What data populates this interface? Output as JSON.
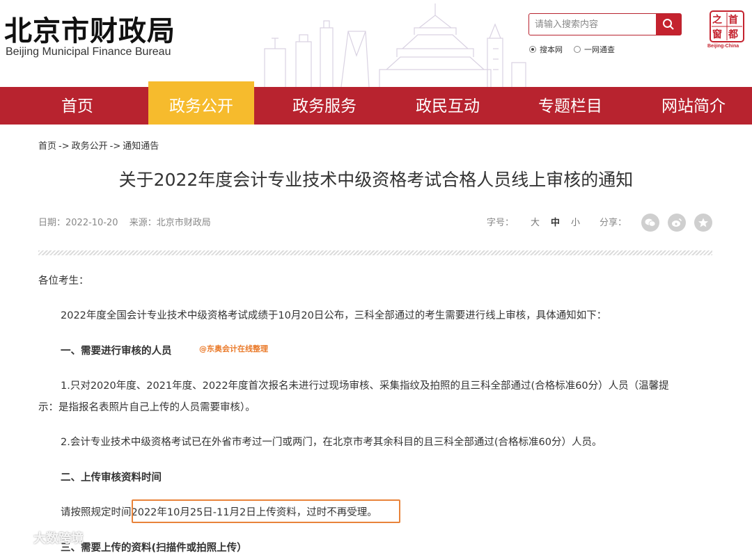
{
  "header": {
    "logo_cn": "北京市财政局",
    "logo_en": "Beijing Municipal Finance Bureau",
    "search_placeholder": "请输入搜索内容",
    "scope_options": [
      "搜本网",
      "一网通查"
    ],
    "seal_chars": [
      "首",
      "都",
      "之",
      "窗"
    ],
    "seal_caption": "Beijing-China"
  },
  "nav": {
    "items": [
      "首页",
      "政务公开",
      "政务服务",
      "政民互动",
      "专题栏目",
      "网站简介"
    ],
    "active_index": 1
  },
  "breadcrumb": [
    "首页",
    "政务公开",
    "通知通告"
  ],
  "breadcrumb_sep": "->",
  "article": {
    "title": "关于2022年度会计专业技术中级资格考试合格人员线上审核的通知",
    "date": "日期：2022-10-20",
    "source": "来源：北京市财政局",
    "font_size_label": "字号：",
    "font_sizes": [
      "大",
      "中",
      "小"
    ],
    "share_label": "分享：",
    "share_icons": [
      "wechat-icon",
      "weibo-icon",
      "favorite-icon"
    ],
    "greeting": "各位考生：",
    "intro": "2022年度全国会计专业技术中级资格考试成绩于10月20日公布，三科全部通过的考生需要进行线上审核，具体通知如下：",
    "h1": "一、需要进行审核的人员",
    "watermark_tag": "@东奥会计在线整理",
    "p1_line1": "1.只对2020年度、2021年度、2022年度首次报名未进行过现场审核、采集指纹及拍照的且三科全部通过(合格标准60分）人员（温馨提",
    "p1_line2": "示：是指报名表照片自己上传的人员需要审核）。",
    "p2": "2.会计专业技术中级资格考试已在外省市考过一门或两门，在北京市考其余科目的且三科全部通过(合格标准60分）人员。",
    "h2": "二、上传审核资料时间",
    "p3_prefix": "请按照规定时间",
    "p3_highlight": "2022年10月25日-11月2日上传资料，过时不再受理。",
    "h3": "三、需要上传的资料(扫描件或拍照上传）"
  },
  "overlay_watermark": "大数跨境",
  "colors": {
    "brand_red": "#b8232f",
    "active_tab": "#f6bb2d",
    "highlight_border": "#e8833a"
  }
}
